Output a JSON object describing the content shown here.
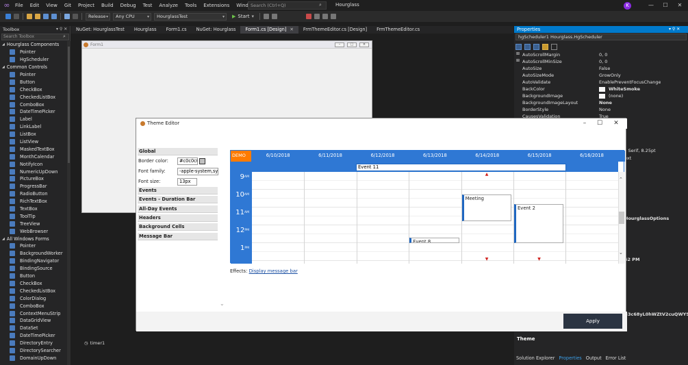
{
  "app": {
    "solution_name": "Hourglass",
    "avatar_initial": "K",
    "accent": "#007acc"
  },
  "menu": [
    "File",
    "Edit",
    "View",
    "Git",
    "Project",
    "Build",
    "Debug",
    "Test",
    "Analyze",
    "Tools",
    "Extensions",
    "Window",
    "Help"
  ],
  "search": {
    "placeholder": "Search (Ctrl+Q)"
  },
  "toolbar": {
    "config": "Release",
    "platform": "Any CPU",
    "project": "HourglassTest",
    "start_label": "Start"
  },
  "toolbox": {
    "title": "Toolbox",
    "search_placeholder": "Search Toolbox",
    "rows": [
      {
        "t": "cat",
        "label": "Hourglass Components"
      },
      {
        "t": "item",
        "label": "Pointer",
        "icon": "pointer-icon"
      },
      {
        "t": "item",
        "label": "HgScheduler",
        "icon": "component-icon"
      },
      {
        "t": "cat",
        "label": "Common Controls"
      },
      {
        "t": "item",
        "label": "Pointer",
        "icon": "pointer-icon"
      },
      {
        "t": "item",
        "label": "Button",
        "icon": "button-icon"
      },
      {
        "t": "item",
        "label": "CheckBox",
        "icon": "checkbox-icon"
      },
      {
        "t": "item",
        "label": "CheckedListBox",
        "icon": "checkedlistbox-icon"
      },
      {
        "t": "item",
        "label": "ComboBox",
        "icon": "combobox-icon"
      },
      {
        "t": "item",
        "label": "DateTimePicker",
        "icon": "datetimepicker-icon"
      },
      {
        "t": "item",
        "label": "Label",
        "icon": "label-icon"
      },
      {
        "t": "item",
        "label": "LinkLabel",
        "icon": "linklabel-icon"
      },
      {
        "t": "item",
        "label": "ListBox",
        "icon": "listbox-icon"
      },
      {
        "t": "item",
        "label": "ListView",
        "icon": "listview-icon"
      },
      {
        "t": "item",
        "label": "MaskedTextBox",
        "icon": "maskedtextbox-icon"
      },
      {
        "t": "item",
        "label": "MonthCalendar",
        "icon": "monthcalendar-icon"
      },
      {
        "t": "item",
        "label": "NotifyIcon",
        "icon": "notifyicon-icon"
      },
      {
        "t": "item",
        "label": "NumericUpDown",
        "icon": "numericupdown-icon"
      },
      {
        "t": "item",
        "label": "PictureBox",
        "icon": "picturebox-icon"
      },
      {
        "t": "item",
        "label": "ProgressBar",
        "icon": "progressbar-icon"
      },
      {
        "t": "item",
        "label": "RadioButton",
        "icon": "radiobutton-icon"
      },
      {
        "t": "item",
        "label": "RichTextBox",
        "icon": "richtextbox-icon"
      },
      {
        "t": "item",
        "label": "TextBox",
        "icon": "textbox-icon"
      },
      {
        "t": "item",
        "label": "ToolTip",
        "icon": "tooltip-icon"
      },
      {
        "t": "item",
        "label": "TreeView",
        "icon": "treeview-icon"
      },
      {
        "t": "item",
        "label": "WebBrowser",
        "icon": "webbrowser-icon"
      },
      {
        "t": "cat",
        "label": "All Windows Forms"
      },
      {
        "t": "item",
        "label": "Pointer",
        "icon": "pointer-icon"
      },
      {
        "t": "item",
        "label": "BackgroundWorker",
        "icon": "backgroundworker-icon"
      },
      {
        "t": "item",
        "label": "BindingNavigator",
        "icon": "bindingnavigator-icon"
      },
      {
        "t": "item",
        "label": "BindingSource",
        "icon": "bindingsource-icon"
      },
      {
        "t": "item",
        "label": "Button",
        "icon": "button-icon"
      },
      {
        "t": "item",
        "label": "CheckBox",
        "icon": "checkbox-icon"
      },
      {
        "t": "item",
        "label": "CheckedListBox",
        "icon": "checkedlistbox-icon"
      },
      {
        "t": "item",
        "label": "ColorDialog",
        "icon": "colordialog-icon"
      },
      {
        "t": "item",
        "label": "ComboBox",
        "icon": "combobox-icon"
      },
      {
        "t": "item",
        "label": "ContextMenuStrip",
        "icon": "contextmenustrip-icon"
      },
      {
        "t": "item",
        "label": "DataGridView",
        "icon": "datagridview-icon"
      },
      {
        "t": "item",
        "label": "DataSet",
        "icon": "dataset-icon"
      },
      {
        "t": "item",
        "label": "DateTimePicker",
        "icon": "datetimepicker-icon"
      },
      {
        "t": "item",
        "label": "DirectoryEntry",
        "icon": "directoryentry-icon"
      },
      {
        "t": "item",
        "label": "DirectorySearcher",
        "icon": "directorysearcher-icon"
      },
      {
        "t": "item",
        "label": "DomainUpDown",
        "icon": "domainupdown-icon"
      }
    ]
  },
  "doc_tabs": [
    {
      "label": "NuGet: HourglassTest",
      "active": false,
      "closable": false
    },
    {
      "label": "Hourglass",
      "active": false,
      "closable": false
    },
    {
      "label": "Form1.cs",
      "active": false,
      "closable": false
    },
    {
      "label": "NuGet: Hourglass",
      "active": false,
      "closable": false
    },
    {
      "label": "Form1.cs [Design]",
      "active": true,
      "closable": true
    },
    {
      "label": "FrmThemeEditor.cs [Design]",
      "active": false,
      "closable": false
    },
    {
      "label": "FrmThemeEditor.cs",
      "active": false,
      "closable": false
    }
  ],
  "designer": {
    "form_title": "Form1",
    "component": "timer1"
  },
  "properties": {
    "title": "Properties",
    "object": "hgScheduler1  Hourglass.HgScheduler",
    "rows": [
      {
        "name": "AutoScrollMargin",
        "value": "0, 0",
        "expand": true
      },
      {
        "name": "AutoScrollMinSize",
        "value": "0, 0",
        "expand": true
      },
      {
        "name": "AutoSize",
        "value": "False"
      },
      {
        "name": "AutoSizeMode",
        "value": "GrowOnly"
      },
      {
        "name": "AutoValidate",
        "value": "EnablePreventFocusChange"
      },
      {
        "name": "BackColor",
        "value": "WhiteSmoke",
        "swatch": "#f5f5f5",
        "bold": true
      },
      {
        "name": "BackgroundImage",
        "value": "(none)",
        "swatch": "#f5f5f5"
      },
      {
        "name": "BackgroundImageLayout",
        "value": "None",
        "bold": true
      },
      {
        "name": "BorderStyle",
        "value": "None"
      },
      {
        "name": "CausesValidation",
        "value": "True"
      }
    ],
    "peek": [
      "s Serif, 8.25pt",
      "ext",
      "HourglassOptions",
      "42 PM",
      "B3c68yL0hWZtV2cuQWYSE"
    ],
    "desc_title": "Theme"
  },
  "bottom_tabs": [
    {
      "label": "Solution Explorer",
      "active": false
    },
    {
      "label": "Properties",
      "active": true
    },
    {
      "label": "Output",
      "active": false
    },
    {
      "label": "Error List",
      "active": false
    }
  ],
  "theme_editor": {
    "title": "Theme Editor",
    "sections": {
      "global": "Global",
      "border_color_label": "Border color:",
      "border_color_value": "#c0c0c0",
      "font_family_label": "Font family:",
      "font_family_value": "-apple-system,system-ui",
      "font_size_label": "Font size:",
      "font_size_value": "13px",
      "others": [
        "Events",
        "Events - Duration Bar",
        "All-Day Events",
        "Headers",
        "Background Cells",
        "Message Bar"
      ]
    },
    "scheduler": {
      "demo_label": "DEMO",
      "days": [
        "6/10/2018",
        "6/11/2018",
        "6/12/2018",
        "6/13/2018",
        "6/14/2018",
        "6/15/2018",
        "6/16/2018"
      ],
      "hours": [
        {
          "h": "9",
          "ap": "AM"
        },
        {
          "h": "10",
          "ap": "AM"
        },
        {
          "h": "11",
          "ap": "AM"
        },
        {
          "h": "12",
          "ap": "PM"
        },
        {
          "h": "1",
          "ap": "PM"
        }
      ],
      "allday_event": "Event 11",
      "events": [
        {
          "label": "Meeting",
          "day": 4,
          "start": 10.25,
          "end": 11.75
        },
        {
          "label": "Event 2",
          "day": 5,
          "start": 10.8,
          "end": 13.0
        },
        {
          "label": "Event 8",
          "day": 3,
          "start": 12.7,
          "end": 13.0
        }
      ],
      "colors": {
        "header": "#2f78d4",
        "demo": "#ff7b00",
        "event_bar": "#1f67c1"
      }
    },
    "effects_label": "Effects:",
    "effects_link": "Display message bar",
    "apply_label": "Apply"
  }
}
